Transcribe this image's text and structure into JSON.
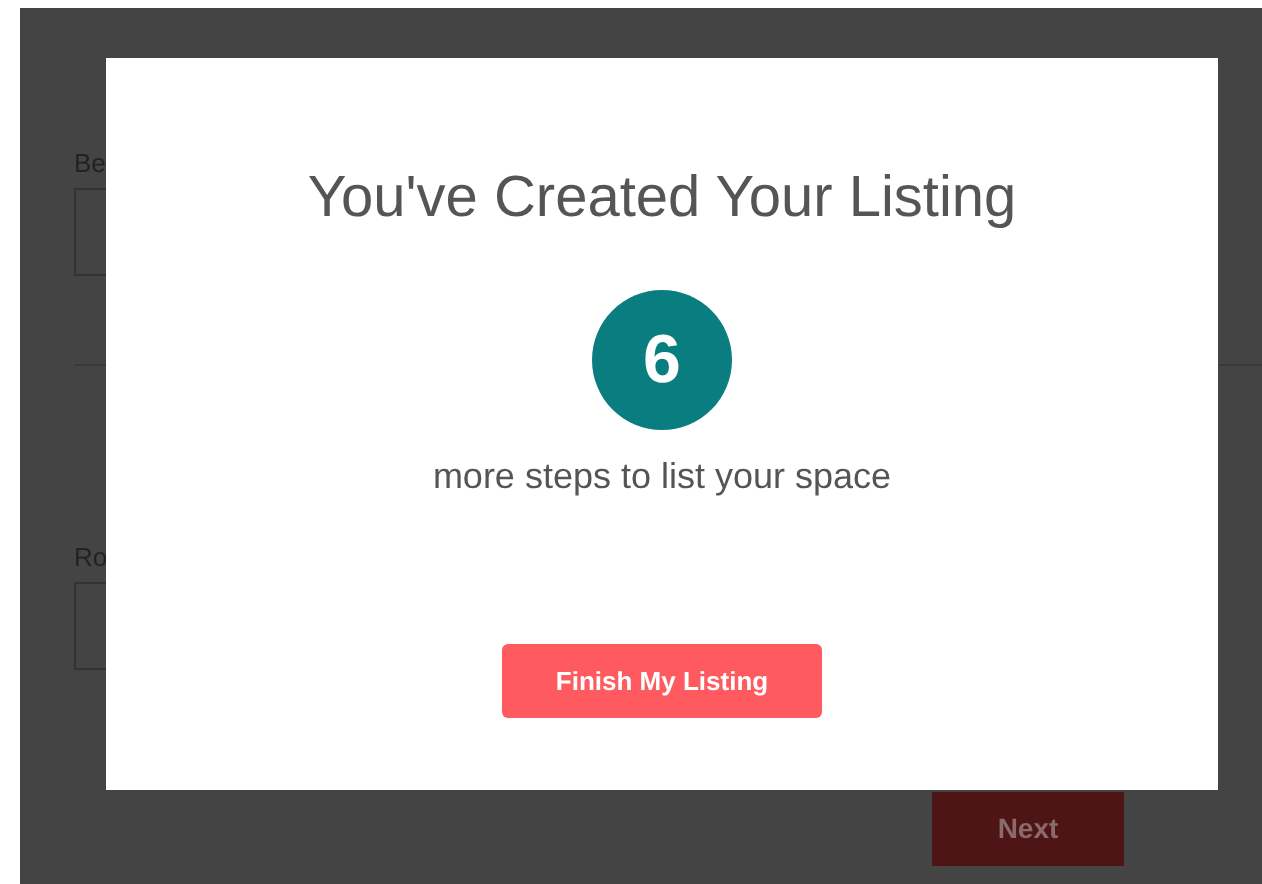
{
  "background_form": {
    "fields": [
      {
        "label": "Be"
      },
      {
        "label": "Ro"
      }
    ],
    "next_button": "Next"
  },
  "modal": {
    "title": "You've Created Your Listing",
    "step_count": "6",
    "subtitle": "more steps to list your space",
    "finish_button": "Finish My Listing"
  }
}
